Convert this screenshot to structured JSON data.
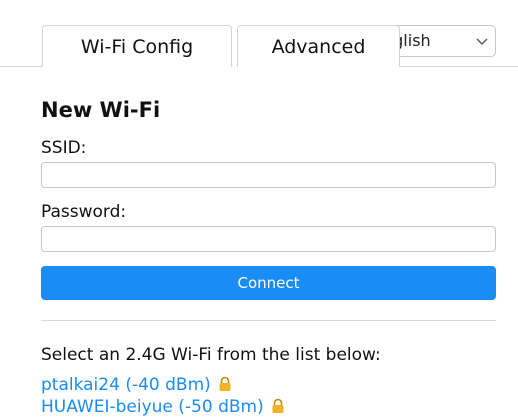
{
  "tabs": [
    {
      "label": "Wi-Fi Config",
      "active": true
    },
    {
      "label": "Advanced",
      "active": false
    }
  ],
  "language": {
    "selected": "nglish"
  },
  "form": {
    "title": "New Wi-Fi",
    "ssid_label": "SSID:",
    "ssid_value": "",
    "password_label": "Password:",
    "password_value": "",
    "connect_label": "Connect"
  },
  "networks": {
    "instruction": "Select an 2.4G Wi-Fi from the list below:",
    "items": [
      {
        "label": "ptalkai24 (-40 dBm)",
        "icon": "lock-icon"
      },
      {
        "label": "HUAWEI-beiyue (-50 dBm)",
        "icon": "lock-icon"
      }
    ]
  },
  "colors": {
    "accent": "#1a8cf5",
    "lock": "#f0b429"
  }
}
